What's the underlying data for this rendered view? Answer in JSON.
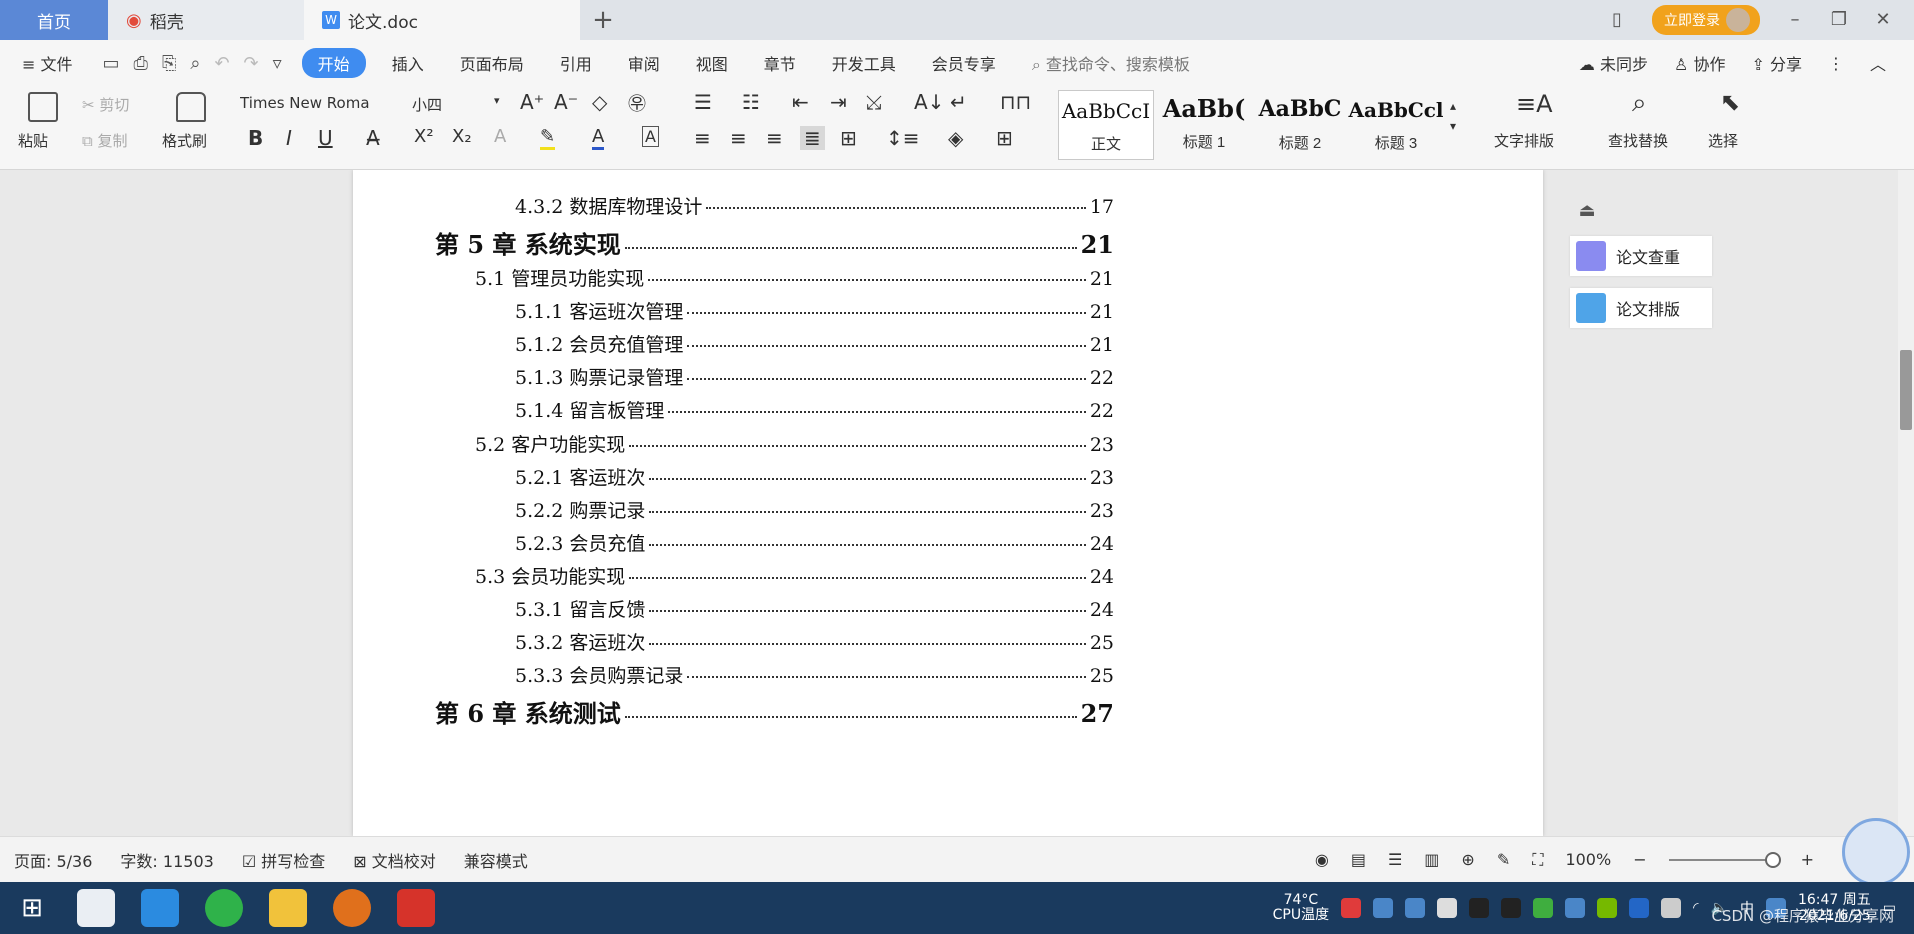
{
  "tabs": {
    "home": "首页",
    "daoke": "稻壳",
    "doc": "论文.doc",
    "new_tab": "+"
  },
  "account": {
    "login_label": "立即登录"
  },
  "menu": {
    "file": "文件",
    "items": [
      "开始",
      "插入",
      "页面布局",
      "引用",
      "审阅",
      "视图",
      "章节",
      "开发工具",
      "会员专享"
    ],
    "active": "开始",
    "search_placeholder": "查找命令、搜索模板",
    "sync": "未同步",
    "collab": "协作",
    "share": "分享"
  },
  "ribbon": {
    "paste": "粘贴",
    "cut": "剪切",
    "copy": "复制",
    "format_painter": "格式刷",
    "font_name": "Times New Roma",
    "font_size": "小四",
    "styles": [
      {
        "sample": "AaBbCcI",
        "name": "正文"
      },
      {
        "sample": "AaBb(",
        "name": "标题 1"
      },
      {
        "sample": "AaBbC",
        "name": "标题 2"
      },
      {
        "sample": "AaBbCcl",
        "name": "标题 3"
      }
    ],
    "text_layout": "文字排版",
    "find_replace": "查找替换",
    "select": "选择"
  },
  "toc": [
    {
      "level": 3,
      "num": "4.3.2",
      "title": "数据库物理设计",
      "page": "17"
    },
    {
      "level": 1,
      "num": "第 5 章",
      "title": "系统实现",
      "page": "21"
    },
    {
      "level": 2,
      "num": "5.1",
      "title": "管理员功能实现",
      "page": "21"
    },
    {
      "level": 3,
      "num": "5.1.1",
      "title": "客运班次管理",
      "page": "21"
    },
    {
      "level": 3,
      "num": "5.1.2",
      "title": "会员充值管理",
      "page": "21"
    },
    {
      "level": 3,
      "num": "5.1.3",
      "title": "购票记录管理",
      "page": "22"
    },
    {
      "level": 3,
      "num": "5.1.4",
      "title": "留言板管理",
      "page": "22"
    },
    {
      "level": 2,
      "num": "5.2",
      "title": "客户功能实现",
      "page": "23"
    },
    {
      "level": 3,
      "num": "5.2.1",
      "title": "客运班次",
      "page": "23"
    },
    {
      "level": 3,
      "num": "5.2.2",
      "title": "购票记录",
      "page": "23"
    },
    {
      "level": 3,
      "num": "5.2.3",
      "title": "会员充值",
      "page": "24"
    },
    {
      "level": 2,
      "num": "5.3",
      "title": "会员功能实现",
      "page": "24"
    },
    {
      "level": 3,
      "num": "5.3.1",
      "title": "留言反馈",
      "page": "24"
    },
    {
      "level": 3,
      "num": "5.3.2",
      "title": "客运班次",
      "page": "25"
    },
    {
      "level": 3,
      "num": "5.3.3",
      "title": "会员购票记录",
      "page": "25"
    },
    {
      "level": 1,
      "num": "第 6 章",
      "title": "系统测试",
      "page": "27"
    }
  ],
  "side_panel": {
    "check": "论文查重",
    "layout": "论文排版"
  },
  "status": {
    "page": "页面: 5/36",
    "words": "字数: 11503",
    "spell": "拼写检查",
    "proof": "文档校对",
    "compat": "兼容模式",
    "zoom": "100%"
  },
  "taskbar": {
    "temp": "74°C",
    "cpu": "CPU温度",
    "time": "16:47 周五",
    "date": "2021/6/25",
    "lang": "中",
    "watermark": "CSDN @程序猿毕业分享网"
  },
  "colors": {
    "accent": "#3f8cf0",
    "home_tab": "#5b88d6",
    "login": "#f1a21c",
    "taskbar": "#1a3a5e"
  }
}
